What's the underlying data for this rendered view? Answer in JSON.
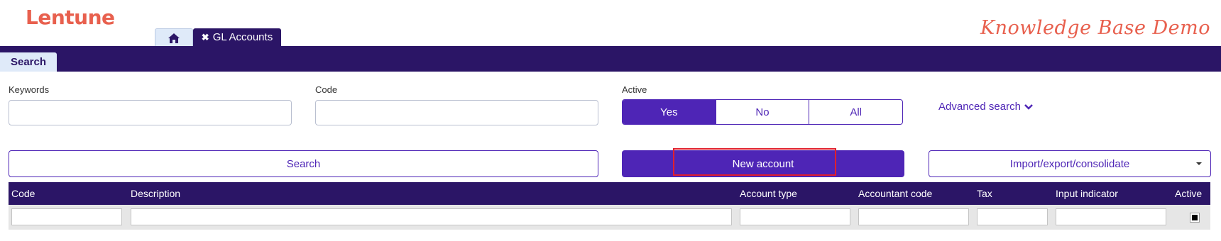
{
  "app": {
    "logo": "Lentune",
    "tagline": "Knowledge Base Demo"
  },
  "tabs": {
    "home_icon": "home-icon",
    "active_tab": "GL Accounts"
  },
  "search_tab": "Search",
  "filters": {
    "keywords": {
      "label": "Keywords",
      "value": ""
    },
    "code": {
      "label": "Code",
      "value": ""
    },
    "active": {
      "label": "Active",
      "options": [
        "Yes",
        "No",
        "All"
      ],
      "selected": "Yes"
    },
    "advanced": "Advanced search"
  },
  "actions": {
    "search": "Search",
    "new_account": "New account",
    "import_export": "Import/export/consolidate"
  },
  "table": {
    "columns": [
      "Code",
      "Description",
      "Account type",
      "Accountant code",
      "Tax",
      "Input indicator",
      "Active"
    ],
    "active_filter_checked": true
  },
  "colors": {
    "brand": "#e8604e",
    "navy": "#2b1566",
    "accent": "#4e25b6",
    "highlight": "#e0202e"
  }
}
